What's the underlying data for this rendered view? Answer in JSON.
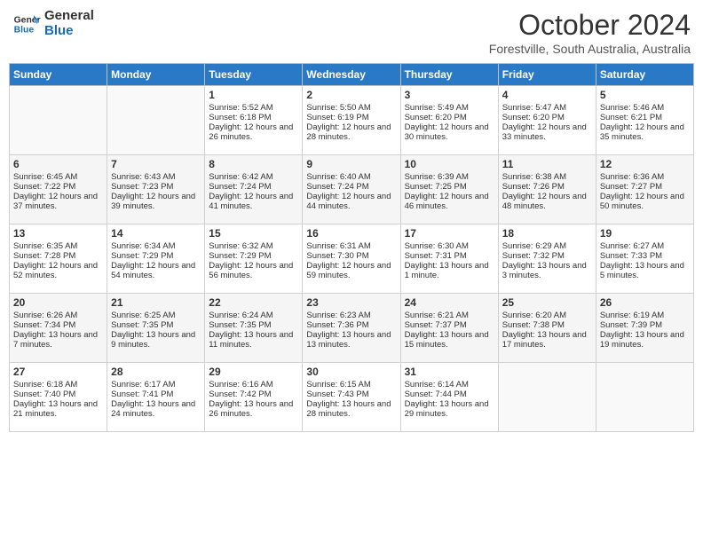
{
  "logo": {
    "line1": "General",
    "line2": "Blue"
  },
  "title": "October 2024",
  "subtitle": "Forestville, South Australia, Australia",
  "days_header": [
    "Sunday",
    "Monday",
    "Tuesday",
    "Wednesday",
    "Thursday",
    "Friday",
    "Saturday"
  ],
  "weeks": [
    [
      {
        "day": "",
        "sunrise": "",
        "sunset": "",
        "daylight": ""
      },
      {
        "day": "",
        "sunrise": "",
        "sunset": "",
        "daylight": ""
      },
      {
        "day": "1",
        "sunrise": "Sunrise: 5:52 AM",
        "sunset": "Sunset: 6:18 PM",
        "daylight": "Daylight: 12 hours and 26 minutes."
      },
      {
        "day": "2",
        "sunrise": "Sunrise: 5:50 AM",
        "sunset": "Sunset: 6:19 PM",
        "daylight": "Daylight: 12 hours and 28 minutes."
      },
      {
        "day": "3",
        "sunrise": "Sunrise: 5:49 AM",
        "sunset": "Sunset: 6:20 PM",
        "daylight": "Daylight: 12 hours and 30 minutes."
      },
      {
        "day": "4",
        "sunrise": "Sunrise: 5:47 AM",
        "sunset": "Sunset: 6:20 PM",
        "daylight": "Daylight: 12 hours and 33 minutes."
      },
      {
        "day": "5",
        "sunrise": "Sunrise: 5:46 AM",
        "sunset": "Sunset: 6:21 PM",
        "daylight": "Daylight: 12 hours and 35 minutes."
      }
    ],
    [
      {
        "day": "6",
        "sunrise": "Sunrise: 6:45 AM",
        "sunset": "Sunset: 7:22 PM",
        "daylight": "Daylight: 12 hours and 37 minutes."
      },
      {
        "day": "7",
        "sunrise": "Sunrise: 6:43 AM",
        "sunset": "Sunset: 7:23 PM",
        "daylight": "Daylight: 12 hours and 39 minutes."
      },
      {
        "day": "8",
        "sunrise": "Sunrise: 6:42 AM",
        "sunset": "Sunset: 7:24 PM",
        "daylight": "Daylight: 12 hours and 41 minutes."
      },
      {
        "day": "9",
        "sunrise": "Sunrise: 6:40 AM",
        "sunset": "Sunset: 7:24 PM",
        "daylight": "Daylight: 12 hours and 44 minutes."
      },
      {
        "day": "10",
        "sunrise": "Sunrise: 6:39 AM",
        "sunset": "Sunset: 7:25 PM",
        "daylight": "Daylight: 12 hours and 46 minutes."
      },
      {
        "day": "11",
        "sunrise": "Sunrise: 6:38 AM",
        "sunset": "Sunset: 7:26 PM",
        "daylight": "Daylight: 12 hours and 48 minutes."
      },
      {
        "day": "12",
        "sunrise": "Sunrise: 6:36 AM",
        "sunset": "Sunset: 7:27 PM",
        "daylight": "Daylight: 12 hours and 50 minutes."
      }
    ],
    [
      {
        "day": "13",
        "sunrise": "Sunrise: 6:35 AM",
        "sunset": "Sunset: 7:28 PM",
        "daylight": "Daylight: 12 hours and 52 minutes."
      },
      {
        "day": "14",
        "sunrise": "Sunrise: 6:34 AM",
        "sunset": "Sunset: 7:29 PM",
        "daylight": "Daylight: 12 hours and 54 minutes."
      },
      {
        "day": "15",
        "sunrise": "Sunrise: 6:32 AM",
        "sunset": "Sunset: 7:29 PM",
        "daylight": "Daylight: 12 hours and 56 minutes."
      },
      {
        "day": "16",
        "sunrise": "Sunrise: 6:31 AM",
        "sunset": "Sunset: 7:30 PM",
        "daylight": "Daylight: 12 hours and 59 minutes."
      },
      {
        "day": "17",
        "sunrise": "Sunrise: 6:30 AM",
        "sunset": "Sunset: 7:31 PM",
        "daylight": "Daylight: 13 hours and 1 minute."
      },
      {
        "day": "18",
        "sunrise": "Sunrise: 6:29 AM",
        "sunset": "Sunset: 7:32 PM",
        "daylight": "Daylight: 13 hours and 3 minutes."
      },
      {
        "day": "19",
        "sunrise": "Sunrise: 6:27 AM",
        "sunset": "Sunset: 7:33 PM",
        "daylight": "Daylight: 13 hours and 5 minutes."
      }
    ],
    [
      {
        "day": "20",
        "sunrise": "Sunrise: 6:26 AM",
        "sunset": "Sunset: 7:34 PM",
        "daylight": "Daylight: 13 hours and 7 minutes."
      },
      {
        "day": "21",
        "sunrise": "Sunrise: 6:25 AM",
        "sunset": "Sunset: 7:35 PM",
        "daylight": "Daylight: 13 hours and 9 minutes."
      },
      {
        "day": "22",
        "sunrise": "Sunrise: 6:24 AM",
        "sunset": "Sunset: 7:35 PM",
        "daylight": "Daylight: 13 hours and 11 minutes."
      },
      {
        "day": "23",
        "sunrise": "Sunrise: 6:23 AM",
        "sunset": "Sunset: 7:36 PM",
        "daylight": "Daylight: 13 hours and 13 minutes."
      },
      {
        "day": "24",
        "sunrise": "Sunrise: 6:21 AM",
        "sunset": "Sunset: 7:37 PM",
        "daylight": "Daylight: 13 hours and 15 minutes."
      },
      {
        "day": "25",
        "sunrise": "Sunrise: 6:20 AM",
        "sunset": "Sunset: 7:38 PM",
        "daylight": "Daylight: 13 hours and 17 minutes."
      },
      {
        "day": "26",
        "sunrise": "Sunrise: 6:19 AM",
        "sunset": "Sunset: 7:39 PM",
        "daylight": "Daylight: 13 hours and 19 minutes."
      }
    ],
    [
      {
        "day": "27",
        "sunrise": "Sunrise: 6:18 AM",
        "sunset": "Sunset: 7:40 PM",
        "daylight": "Daylight: 13 hours and 21 minutes."
      },
      {
        "day": "28",
        "sunrise": "Sunrise: 6:17 AM",
        "sunset": "Sunset: 7:41 PM",
        "daylight": "Daylight: 13 hours and 24 minutes."
      },
      {
        "day": "29",
        "sunrise": "Sunrise: 6:16 AM",
        "sunset": "Sunset: 7:42 PM",
        "daylight": "Daylight: 13 hours and 26 minutes."
      },
      {
        "day": "30",
        "sunrise": "Sunrise: 6:15 AM",
        "sunset": "Sunset: 7:43 PM",
        "daylight": "Daylight: 13 hours and 28 minutes."
      },
      {
        "day": "31",
        "sunrise": "Sunrise: 6:14 AM",
        "sunset": "Sunset: 7:44 PM",
        "daylight": "Daylight: 13 hours and 29 minutes."
      },
      {
        "day": "",
        "sunrise": "",
        "sunset": "",
        "daylight": ""
      },
      {
        "day": "",
        "sunrise": "",
        "sunset": "",
        "daylight": ""
      }
    ]
  ]
}
